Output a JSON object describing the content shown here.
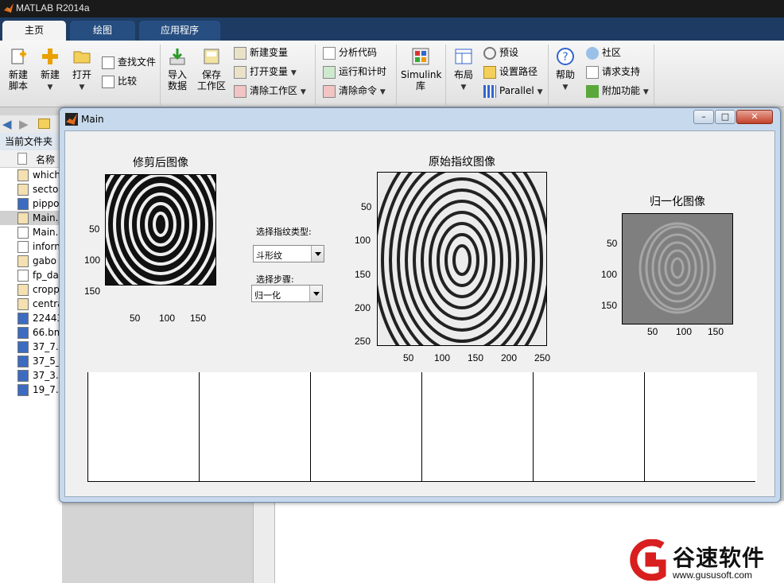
{
  "app": {
    "title": "MATLAB R2014a"
  },
  "ribbon": {
    "tabs": [
      "主页",
      "绘图",
      "应用程序"
    ],
    "file": {
      "new_script": "新建\n脚本",
      "new": "新建",
      "open": "打开",
      "find_files": "查找文件",
      "compare": "比较"
    },
    "variable": {
      "import_data": "导入\n数据",
      "save_workspace": "保存\n工作区",
      "new_variable": "新建变量",
      "open_variable": "打开变量",
      "clear_workspace": "清除工作区"
    },
    "code": {
      "analyze_code": "分析代码",
      "run_and_time": "运行和计时",
      "clear_commands": "清除命令"
    },
    "simulink": {
      "library": "Simulink\n库"
    },
    "environment": {
      "layout": "布局",
      "preferences": "预设",
      "set_path": "设置路径",
      "parallel": "Parallel"
    },
    "resources": {
      "help": "帮助",
      "community": "社区",
      "request_support": "请求支持",
      "add_ons": "附加功能"
    }
  },
  "current_folder": {
    "label": "当前文件夹",
    "name_header": "名称",
    "files": [
      {
        "name": "which",
        "type": "m"
      },
      {
        "name": "secto",
        "type": "m"
      },
      {
        "name": "pippo",
        "type": "bmp"
      },
      {
        "name": "Main.",
        "type": "m",
        "selected": true
      },
      {
        "name": "Main.",
        "type": "fig"
      },
      {
        "name": "inforn",
        "type": "mat"
      },
      {
        "name": "gabo",
        "type": "m"
      },
      {
        "name": "fp_da",
        "type": "fig"
      },
      {
        "name": "cropp",
        "type": "m"
      },
      {
        "name": "centra",
        "type": "m"
      },
      {
        "name": "22443",
        "type": "bmp"
      },
      {
        "name": "66.bm",
        "type": "bmp"
      },
      {
        "name": "37_7.b",
        "type": "bmp"
      },
      {
        "name": "37_5_",
        "type": "bmp"
      },
      {
        "name": "37_3.b",
        "type": "bmp"
      },
      {
        "name": "19_7.b",
        "type": "bmp"
      }
    ]
  },
  "figure": {
    "title": "Main",
    "window_buttons": {
      "minimize": "–",
      "maximize": "□",
      "close": "✕"
    },
    "cropped": {
      "title": "修剪后图像",
      "xticks": [
        "50",
        "100",
        "150"
      ],
      "yticks": [
        "50",
        "100",
        "150"
      ]
    },
    "original": {
      "title": "原始指纹图像",
      "xticks": [
        "50",
        "100",
        "150",
        "200",
        "250"
      ],
      "yticks": [
        "50",
        "100",
        "150",
        "200",
        "250"
      ]
    },
    "normalized": {
      "title": "归一化图像",
      "xticks": [
        "50",
        "100",
        "150"
      ],
      "yticks": [
        "50",
        "100",
        "150"
      ]
    },
    "controls": {
      "type_label": "选择指纹类型:",
      "type_value": "斗形纹",
      "step_label": "选择步骤:",
      "step_value": "归一化"
    }
  },
  "watermark": {
    "name": "谷速软件",
    "url": "www.gususoft.com"
  }
}
